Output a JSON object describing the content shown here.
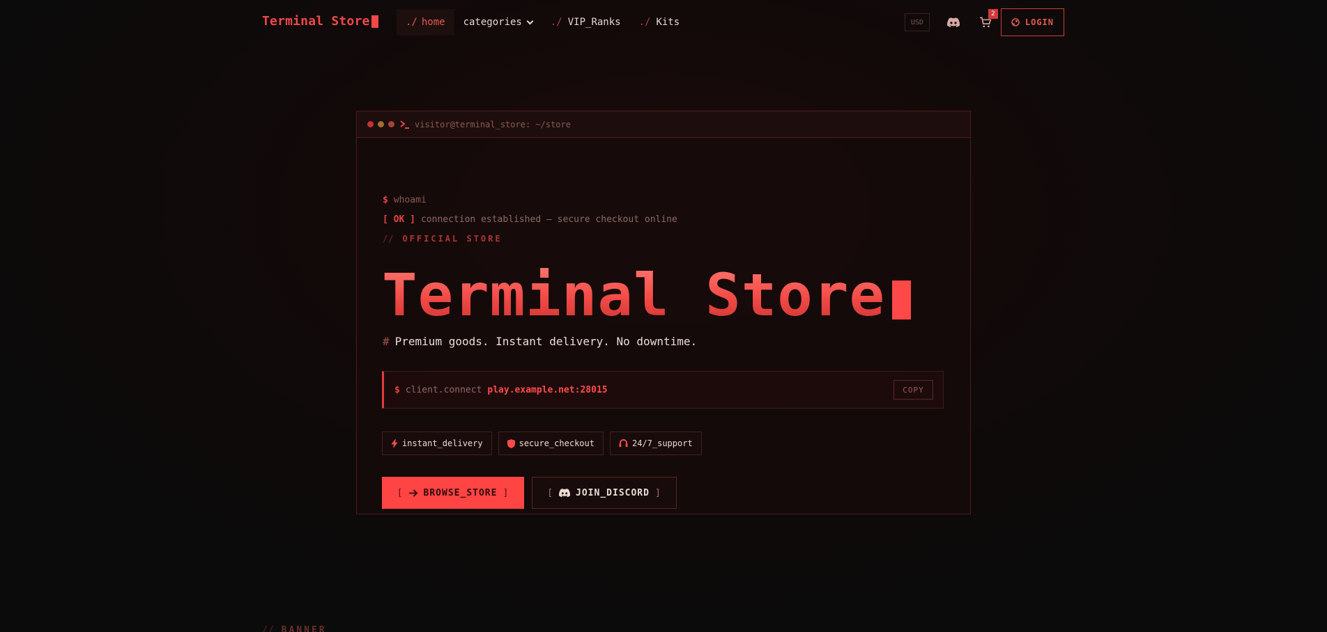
{
  "nav": {
    "brand": "Terminal Store",
    "links": [
      {
        "prefix": "./",
        "label": "home",
        "active": true
      },
      {
        "prefix": "",
        "label": "categories",
        "dropdown": true
      },
      {
        "prefix": "./",
        "label": "VIP_Ranks"
      },
      {
        "prefix": "./",
        "label": "Kits"
      }
    ],
    "currency": "USD",
    "cart_count": "2",
    "login_label": "LOGIN"
  },
  "terminal": {
    "title": "visitor@terminal_store: ~/store",
    "line1_prompt": "$",
    "line1_cmd": "whoami",
    "line2_status": "[ OK ]",
    "line2_text": "connection established — secure checkout online",
    "line3_slashes": "//",
    "line3_text": "OFFICIAL STORE",
    "hero_title": "Terminal Store",
    "tagline_hash": "#",
    "tagline": "Premium goods. Instant delivery. No downtime.",
    "connect_prompt": "$",
    "connect_cmd": "client.connect",
    "connect_addr": "play.example.net:28015",
    "copy_label": "COPY",
    "badges": [
      {
        "icon": "bolt-icon",
        "label": "instant_delivery"
      },
      {
        "icon": "shield-icon",
        "label": "secure_checkout"
      },
      {
        "icon": "headset-icon",
        "label": "24/7_support"
      }
    ],
    "browse_label": "BROWSE_STORE",
    "discord_label": "JOIN_DISCORD",
    "bracket_open": "[",
    "bracket_close": "]"
  },
  "banner": {
    "slashes": "//",
    "label": "BANNER"
  },
  "colors": {
    "accent": "#ff4444",
    "background": "#0b0b0b",
    "border": "#4e1c1c",
    "text": "#e8d6d2"
  }
}
